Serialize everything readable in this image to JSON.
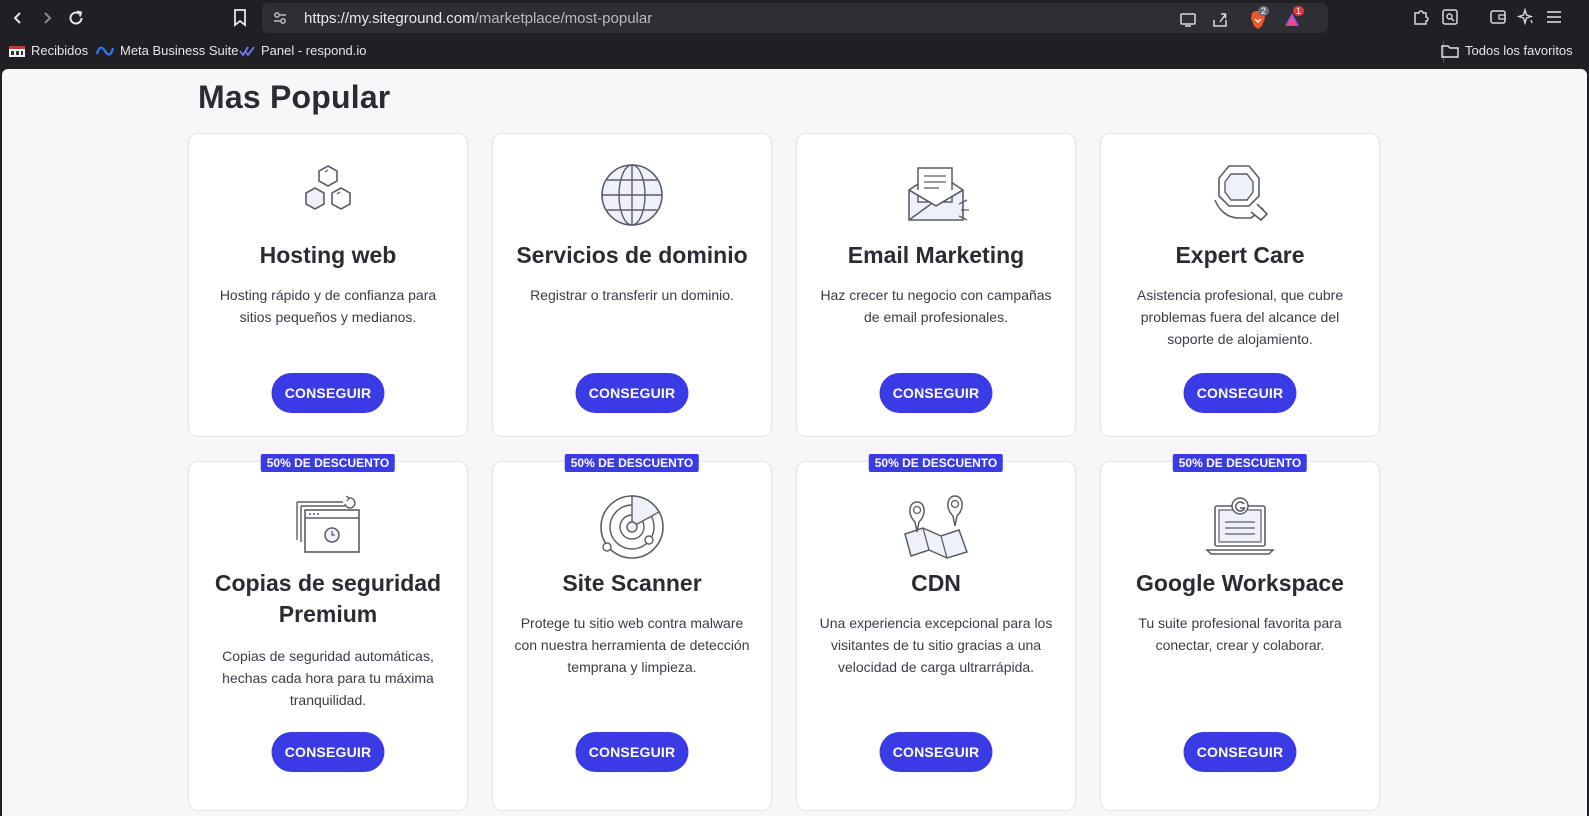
{
  "browser": {
    "url_host": "https://my.siteground.com",
    "url_path": "/marketplace/most-popular",
    "brave_count": "2",
    "alert_count": "1"
  },
  "bookmarks": {
    "items": [
      {
        "label": "Recibidos"
      },
      {
        "label": "Meta Business Suite"
      },
      {
        "label": "Panel - respond.io"
      }
    ],
    "all_favorites": "Todos los favoritos"
  },
  "page": {
    "title": "Mas Popular",
    "cards": [
      {
        "title": "Hosting web",
        "desc": "Hosting rápido y de confianza para sitios pequeños y medianos.",
        "cta": "CONSEGUIR",
        "icon": "hexagons-icon"
      },
      {
        "title": "Servicios de dominio",
        "desc": "Registrar o transferir un dominio.",
        "cta": "CONSEGUIR",
        "icon": "globe-icon"
      },
      {
        "title": "Email Marketing",
        "desc": "Haz crecer tu negocio con campañas de email profesionales.",
        "cta": "CONSEGUIR",
        "icon": "envelope-icon"
      },
      {
        "title": "Expert Care",
        "desc": "Asistencia profesional, que cubre problemas fuera del alcance del soporte de alojamiento.",
        "cta": "CONSEGUIR",
        "icon": "care-hand-icon"
      },
      {
        "title": "Copias de seguridad Premium",
        "desc": "Copias de seguridad automáticas, hechas cada hora para tu máxima tranquilidad.",
        "cta": "CONSEGUIR",
        "badge": "50% DE DESCUENTO",
        "icon": "backup-icon"
      },
      {
        "title": "Site Scanner",
        "desc": "Protege tu sitio web contra malware con nuestra herramienta de detección temprana y limpieza.",
        "cta": "CONSEGUIR",
        "badge": "50% DE DESCUENTO",
        "icon": "radar-icon"
      },
      {
        "title": "CDN",
        "desc": "Una experiencia excepcional para los visitantes de tu sitio gracias a una velocidad de carga ultrarrápida.",
        "cta": "CONSEGUIR",
        "badge": "50% DE DESCUENTO",
        "icon": "map-pins-icon"
      },
      {
        "title": "Google Workspace",
        "desc": "Tu suite profesional favorita para conectar, crear y colaborar.",
        "cta": "CONSEGUIR",
        "badge": "50% DE DESCUENTO",
        "icon": "google-laptop-icon"
      }
    ]
  },
  "colors": {
    "accent": "#3b3be6",
    "chrome": "#1f1f24",
    "page_bg": "#f7f7f9"
  }
}
